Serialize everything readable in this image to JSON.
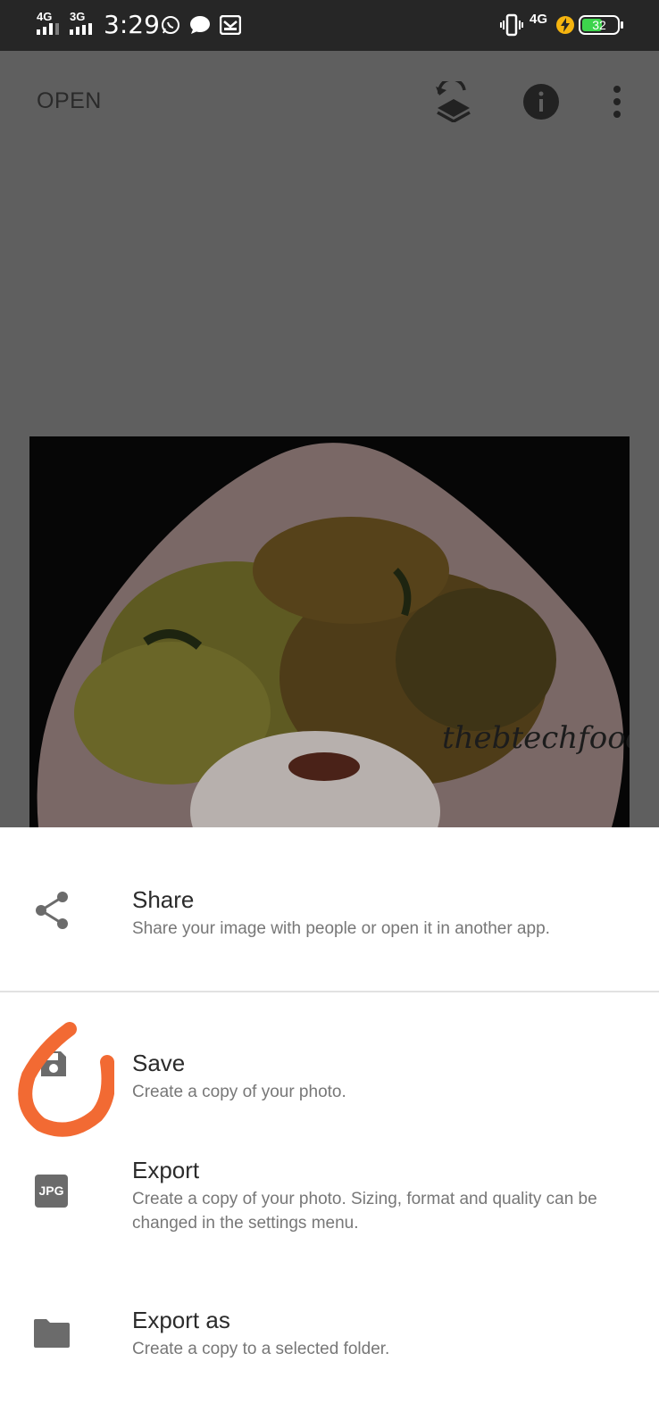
{
  "status_bar": {
    "net1": "4G",
    "net2": "3G",
    "time": "3:29",
    "net3": "4G",
    "battery": "32",
    "icons": [
      "whatsapp-icon",
      "message-icon",
      "gmail-icon",
      "vibrate-icon",
      "charging-icon"
    ]
  },
  "toolbar": {
    "open_label": "OPEN",
    "icons": [
      "layers-undo-icon",
      "info-icon",
      "more-vert-icon"
    ]
  },
  "photo": {
    "watermark": "thebtechfoodie"
  },
  "sheet": {
    "items": [
      {
        "label": "Share",
        "desc": "Share your image with people or open it in another app.",
        "icon": "share-icon"
      },
      {
        "label": "Save",
        "desc": "Create a copy of your photo.",
        "icon": "save-icon"
      },
      {
        "label": "Export",
        "desc": "Create a copy of your photo. Sizing, format and quality can be changed in the settings menu.",
        "icon": "jpg-icon",
        "icon_text": "JPG"
      },
      {
        "label": "Export as",
        "desc": "Create a copy to a selected folder.",
        "icon": "folder-icon"
      }
    ]
  },
  "colors": {
    "status_bar": "#262626",
    "dim_overlay": "#5f5f5f",
    "sheet_bg": "#ffffff",
    "battery_fill": "#3dd44c",
    "highlight_marker": "#f26a33"
  }
}
